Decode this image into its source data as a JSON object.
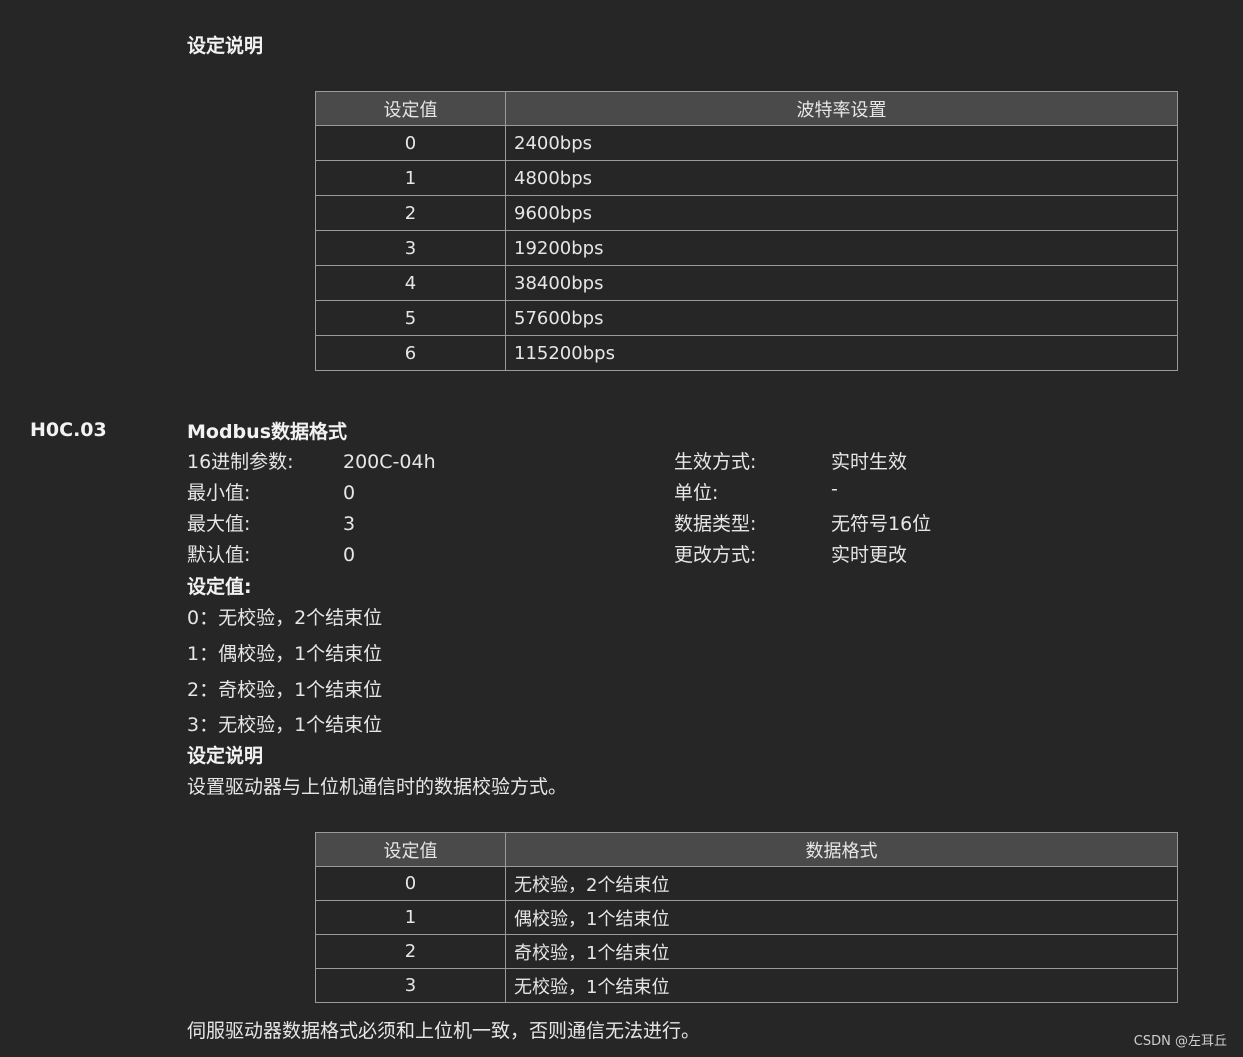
{
  "section1": {
    "title": "设定说明"
  },
  "baud_table": {
    "headers": [
      "设定值",
      "波特率设置"
    ],
    "rows": [
      [
        "0",
        "2400bps"
      ],
      [
        "1",
        "4800bps"
      ],
      [
        "2",
        "9600bps"
      ],
      [
        "3",
        "19200bps"
      ],
      [
        "4",
        "38400bps"
      ],
      [
        "5",
        "57600bps"
      ],
      [
        "6",
        "115200bps"
      ]
    ]
  },
  "param": {
    "code": "H0C.03",
    "name": "Modbus数据格式",
    "left_fields": [
      {
        "label": "16进制参数:",
        "value": "200C-04h"
      },
      {
        "label": "最小值:",
        "value": "0"
      },
      {
        "label": "最大值:",
        "value": "3"
      },
      {
        "label": "默认值:",
        "value": "0"
      }
    ],
    "right_fields": [
      {
        "label": "生效方式:",
        "value": "实时生效"
      },
      {
        "label": "单位:",
        "value": "-"
      },
      {
        "label": "数据类型:",
        "value": "无符号16位"
      },
      {
        "label": "更改方式:",
        "value": "实时更改"
      }
    ],
    "settings_title": "设定值:",
    "settings": [
      "0：无校验，2个结束位",
      "1：偶校验，1个结束位",
      "2：奇校验，1个结束位",
      "3：无校验，1个结束位"
    ],
    "desc_title": "设定说明",
    "desc_text": "设置驱动器与上位机通信时的数据校验方式。"
  },
  "format_table": {
    "headers": [
      "设定值",
      "数据格式"
    ],
    "rows": [
      [
        "0",
        "无校验，2个结束位"
      ],
      [
        "1",
        "偶校验，1个结束位"
      ],
      [
        "2",
        "奇校验，1个结束位"
      ],
      [
        "3",
        "无校验，1个结束位"
      ]
    ]
  },
  "footer_note": "伺服驱动器数据格式必须和上位机一致，否则通信无法进行。",
  "watermark": "CSDN @左耳丘"
}
